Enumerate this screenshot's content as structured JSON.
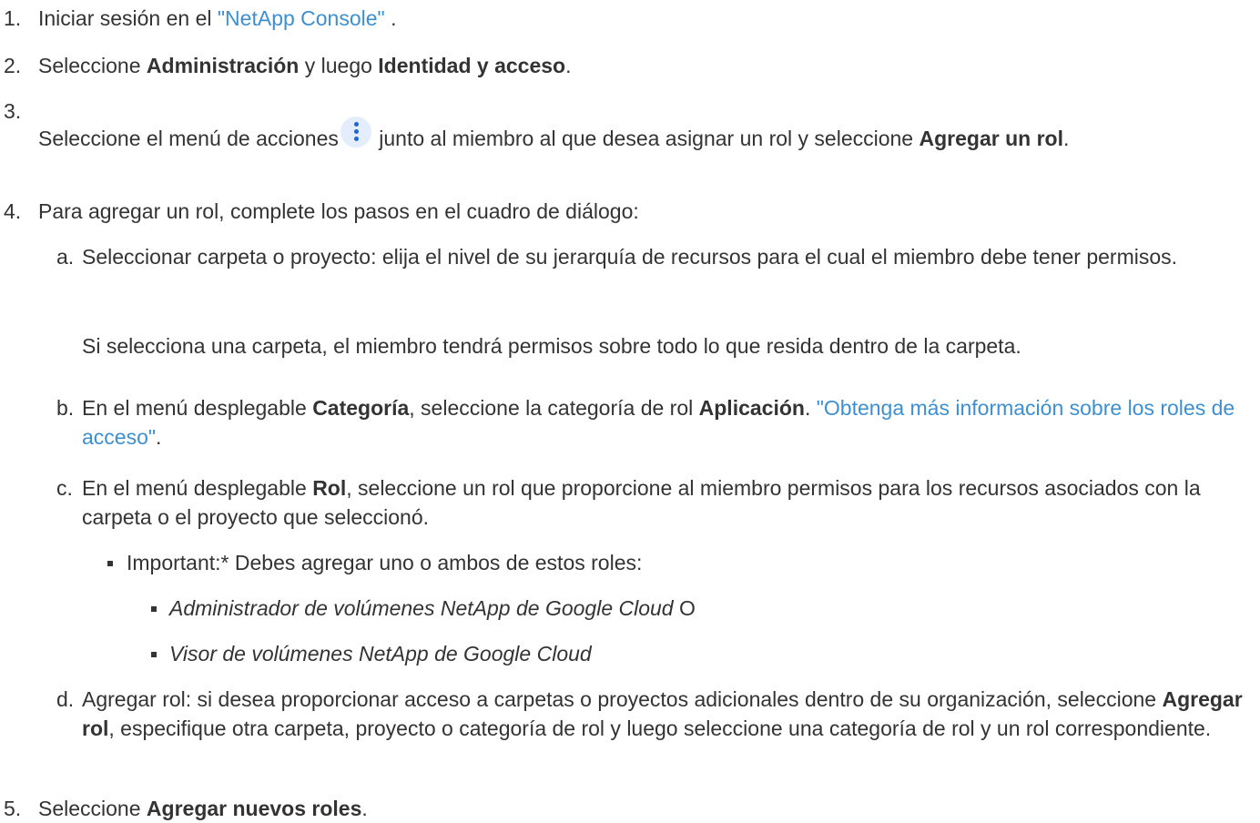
{
  "steps": {
    "s1": {
      "num": "1.",
      "prefix": "Iniciar sesión en el ",
      "link": "\"NetApp Console\"",
      "suffix": " ."
    },
    "s2": {
      "num": "2.",
      "prefix": "Seleccione ",
      "b1": "Administración",
      "mid": " y luego ",
      "b2": "Identidad y acceso",
      "suffix": "."
    },
    "s3": {
      "num": "3.",
      "prefix": "Seleccione el menú de acciones",
      "mid": " junto al miembro al que desea asignar un rol y seleccione ",
      "b1": "Agregar un rol",
      "suffix": "."
    },
    "s4": {
      "num": "4.",
      "text": "Para agregar un rol, complete los pasos en el cuadro de diálogo:",
      "a": {
        "letter": "a.",
        "text": "Seleccionar carpeta o proyecto: elija el nivel de su jerarquía de recursos para el cual el miembro debe tener permisos.",
        "note": "Si selecciona una carpeta, el miembro tendrá permisos sobre todo lo que resida dentro de la carpeta."
      },
      "b": {
        "letter": "b.",
        "prefix": "En el menú desplegable ",
        "b1": "Categoría",
        "mid": ", seleccione la categoría de rol ",
        "b2": "Aplicación",
        "mid2": ". ",
        "link": "\"Obtenga más información sobre los roles de acceso\"",
        "suffix": "."
      },
      "c": {
        "letter": "c.",
        "prefix": "En el menú desplegable ",
        "b1": "Rol",
        "text": ", seleccione un rol que proporcione al miembro permisos para los recursos asociados con la carpeta o el proyecto que seleccionó.",
        "important": "Important:* Debes agregar uno o ambos de estos roles:",
        "roles": [
          {
            "name": "Administrador de volúmenes NetApp de Google Cloud",
            "suffix": " O"
          },
          {
            "name": "Visor de volúmenes NetApp de Google Cloud",
            "suffix": ""
          }
        ]
      },
      "d": {
        "letter": "d.",
        "prefix": "Agregar rol: si desea proporcionar acceso a carpetas o proyectos adicionales dentro de su organización, seleccione ",
        "b1": "Agregar rol",
        "suffix": ", especifique otra carpeta, proyecto o categoría de rol y luego seleccione una categoría de rol y un rol correspondiente."
      }
    },
    "s5": {
      "num": "5.",
      "prefix": "Seleccione ",
      "b1": "Agregar nuevos roles",
      "suffix": "."
    }
  },
  "icons": {
    "actions_menu": "kebab-vertical-icon"
  },
  "colors": {
    "link": "#3d8fd1",
    "icon_bg": "#e4edfb",
    "icon_dots": "#1a66d6"
  }
}
